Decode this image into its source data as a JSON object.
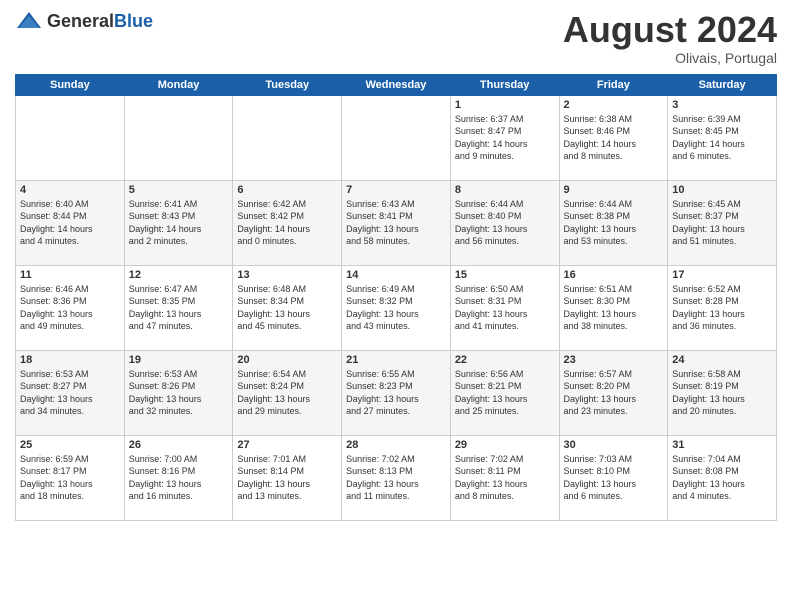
{
  "header": {
    "logo_general": "General",
    "logo_blue": "Blue",
    "month_title": "August 2024",
    "subtitle": "Olivais, Portugal"
  },
  "weekdays": [
    "Sunday",
    "Monday",
    "Tuesday",
    "Wednesday",
    "Thursday",
    "Friday",
    "Saturday"
  ],
  "weeks": [
    [
      {
        "day": "",
        "info": ""
      },
      {
        "day": "",
        "info": ""
      },
      {
        "day": "",
        "info": ""
      },
      {
        "day": "",
        "info": ""
      },
      {
        "day": "1",
        "info": "Sunrise: 6:37 AM\nSunset: 8:47 PM\nDaylight: 14 hours\nand 9 minutes."
      },
      {
        "day": "2",
        "info": "Sunrise: 6:38 AM\nSunset: 8:46 PM\nDaylight: 14 hours\nand 8 minutes."
      },
      {
        "day": "3",
        "info": "Sunrise: 6:39 AM\nSunset: 8:45 PM\nDaylight: 14 hours\nand 6 minutes."
      }
    ],
    [
      {
        "day": "4",
        "info": "Sunrise: 6:40 AM\nSunset: 8:44 PM\nDaylight: 14 hours\nand 4 minutes."
      },
      {
        "day": "5",
        "info": "Sunrise: 6:41 AM\nSunset: 8:43 PM\nDaylight: 14 hours\nand 2 minutes."
      },
      {
        "day": "6",
        "info": "Sunrise: 6:42 AM\nSunset: 8:42 PM\nDaylight: 14 hours\nand 0 minutes."
      },
      {
        "day": "7",
        "info": "Sunrise: 6:43 AM\nSunset: 8:41 PM\nDaylight: 13 hours\nand 58 minutes."
      },
      {
        "day": "8",
        "info": "Sunrise: 6:44 AM\nSunset: 8:40 PM\nDaylight: 13 hours\nand 56 minutes."
      },
      {
        "day": "9",
        "info": "Sunrise: 6:44 AM\nSunset: 8:38 PM\nDaylight: 13 hours\nand 53 minutes."
      },
      {
        "day": "10",
        "info": "Sunrise: 6:45 AM\nSunset: 8:37 PM\nDaylight: 13 hours\nand 51 minutes."
      }
    ],
    [
      {
        "day": "11",
        "info": "Sunrise: 6:46 AM\nSunset: 8:36 PM\nDaylight: 13 hours\nand 49 minutes."
      },
      {
        "day": "12",
        "info": "Sunrise: 6:47 AM\nSunset: 8:35 PM\nDaylight: 13 hours\nand 47 minutes."
      },
      {
        "day": "13",
        "info": "Sunrise: 6:48 AM\nSunset: 8:34 PM\nDaylight: 13 hours\nand 45 minutes."
      },
      {
        "day": "14",
        "info": "Sunrise: 6:49 AM\nSunset: 8:32 PM\nDaylight: 13 hours\nand 43 minutes."
      },
      {
        "day": "15",
        "info": "Sunrise: 6:50 AM\nSunset: 8:31 PM\nDaylight: 13 hours\nand 41 minutes."
      },
      {
        "day": "16",
        "info": "Sunrise: 6:51 AM\nSunset: 8:30 PM\nDaylight: 13 hours\nand 38 minutes."
      },
      {
        "day": "17",
        "info": "Sunrise: 6:52 AM\nSunset: 8:28 PM\nDaylight: 13 hours\nand 36 minutes."
      }
    ],
    [
      {
        "day": "18",
        "info": "Sunrise: 6:53 AM\nSunset: 8:27 PM\nDaylight: 13 hours\nand 34 minutes."
      },
      {
        "day": "19",
        "info": "Sunrise: 6:53 AM\nSunset: 8:26 PM\nDaylight: 13 hours\nand 32 minutes."
      },
      {
        "day": "20",
        "info": "Sunrise: 6:54 AM\nSunset: 8:24 PM\nDaylight: 13 hours\nand 29 minutes."
      },
      {
        "day": "21",
        "info": "Sunrise: 6:55 AM\nSunset: 8:23 PM\nDaylight: 13 hours\nand 27 minutes."
      },
      {
        "day": "22",
        "info": "Sunrise: 6:56 AM\nSunset: 8:21 PM\nDaylight: 13 hours\nand 25 minutes."
      },
      {
        "day": "23",
        "info": "Sunrise: 6:57 AM\nSunset: 8:20 PM\nDaylight: 13 hours\nand 23 minutes."
      },
      {
        "day": "24",
        "info": "Sunrise: 6:58 AM\nSunset: 8:19 PM\nDaylight: 13 hours\nand 20 minutes."
      }
    ],
    [
      {
        "day": "25",
        "info": "Sunrise: 6:59 AM\nSunset: 8:17 PM\nDaylight: 13 hours\nand 18 minutes."
      },
      {
        "day": "26",
        "info": "Sunrise: 7:00 AM\nSunset: 8:16 PM\nDaylight: 13 hours\nand 16 minutes."
      },
      {
        "day": "27",
        "info": "Sunrise: 7:01 AM\nSunset: 8:14 PM\nDaylight: 13 hours\nand 13 minutes."
      },
      {
        "day": "28",
        "info": "Sunrise: 7:02 AM\nSunset: 8:13 PM\nDaylight: 13 hours\nand 11 minutes."
      },
      {
        "day": "29",
        "info": "Sunrise: 7:02 AM\nSunset: 8:11 PM\nDaylight: 13 hours\nand 8 minutes."
      },
      {
        "day": "30",
        "info": "Sunrise: 7:03 AM\nSunset: 8:10 PM\nDaylight: 13 hours\nand 6 minutes."
      },
      {
        "day": "31",
        "info": "Sunrise: 7:04 AM\nSunset: 8:08 PM\nDaylight: 13 hours\nand 4 minutes."
      }
    ]
  ]
}
